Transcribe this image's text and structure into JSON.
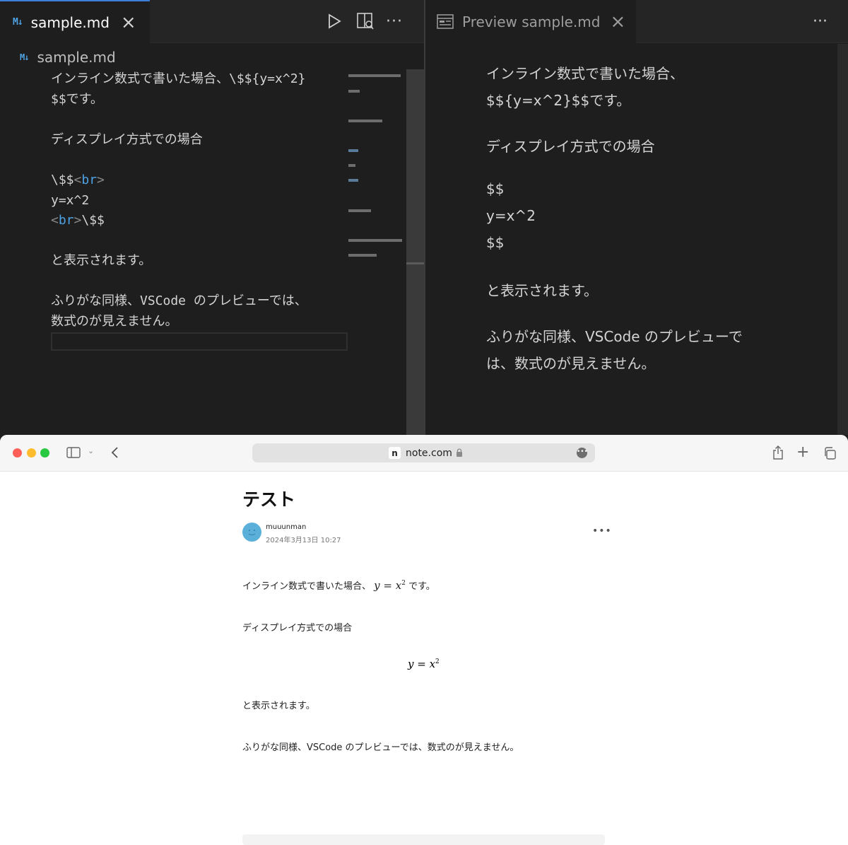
{
  "editor": {
    "tab_icon": "M↓",
    "tab_title": "sample.md",
    "breadcrumb_icon": "M↓",
    "breadcrumb": "sample.md",
    "lines": {
      "l1": "インライン数式で書いた場合、\\$${y=x^2}",
      "l2": "$$です。",
      "l3": "ディスプレイ方式での場合",
      "l4a": "\\$$",
      "l4tag": "br",
      "l5": "y=x^2",
      "l6tag": "br",
      "l6b": "\\$$",
      "l7": "と表示されます。",
      "l8": "ふりがな同様、VSCode のプレビューでは、",
      "l9": "数式のが見えません。"
    }
  },
  "preview": {
    "tab_title": "Preview sample.md",
    "p1a": "インライン数式で書いた場合、",
    "p1b": "$${y=x^2}$$です。",
    "p2": "ディスプレイ方式での場合",
    "p3a": "$$",
    "p3b": "y=x^2",
    "p3c": "$$",
    "p4": "と表示されます。",
    "p5a": "ふりがな同様、VSCode のプレビューで",
    "p5b": "は、数式のが見えません。"
  },
  "browser": {
    "site_badge": "n",
    "url": "note.com",
    "article": {
      "title": "テスト",
      "author": "muuunman",
      "date": "2024年3月13日 10:27",
      "p1_before": "インライン数式で書いた場合、",
      "p1_math": "y = x",
      "p1_exp": "2",
      "p1_after": " です。",
      "p2": "ディスプレイ方式での場合",
      "display_math": "y = x",
      "display_exp": "2",
      "p3": "と表示されます。",
      "p4": "ふりがな同様、VSCode のプレビューでは、数式のが見えません。"
    }
  },
  "colors": {
    "editor_bg": "#1e1e1e",
    "accent_blue": "#4ea2e3",
    "tab_active_border": "#3d7fd6",
    "traffic_red": "#ff5f57",
    "traffic_yellow": "#febc2e",
    "traffic_green": "#28c840"
  }
}
